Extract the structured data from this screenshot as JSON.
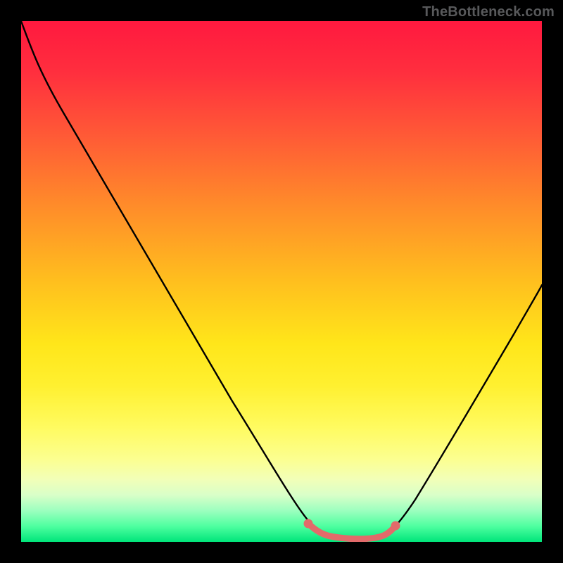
{
  "watermark": "TheBottleneck.com",
  "chart_data": {
    "type": "line",
    "title": "",
    "xlabel": "",
    "ylabel": "",
    "xlim": [
      0,
      100
    ],
    "ylim": [
      0,
      100
    ],
    "series": [
      {
        "name": "bottleneck-curve",
        "x": [
          0,
          4,
          10,
          20,
          30,
          40,
          50,
          55,
          58,
          60,
          64,
          68,
          70,
          72,
          76,
          80,
          86,
          92,
          100
        ],
        "y": [
          100,
          93,
          84,
          70,
          55,
          40,
          24,
          13,
          7,
          3,
          1,
          1,
          1,
          2,
          7,
          14,
          25,
          36,
          50
        ],
        "color": "#000000"
      },
      {
        "name": "highlight-segment",
        "x": [
          55,
          58,
          60,
          62,
          64,
          66,
          68,
          70,
          71
        ],
        "y": [
          3.2,
          2.2,
          1.5,
          1.1,
          1.0,
          1.0,
          1.3,
          2.0,
          2.5
        ],
        "color": "#e26a6a"
      }
    ],
    "markers": [
      {
        "x": 55,
        "y": 3.2,
        "color": "#e26a6a"
      },
      {
        "x": 71,
        "y": 2.5,
        "color": "#e26a6a"
      }
    ],
    "gradient_stops": [
      {
        "pos": 0,
        "color": "#ff193f"
      },
      {
        "pos": 50,
        "color": "#ffbf1e"
      },
      {
        "pos": 78,
        "color": "#fffb60"
      },
      {
        "pos": 100,
        "color": "#00e57a"
      }
    ]
  }
}
